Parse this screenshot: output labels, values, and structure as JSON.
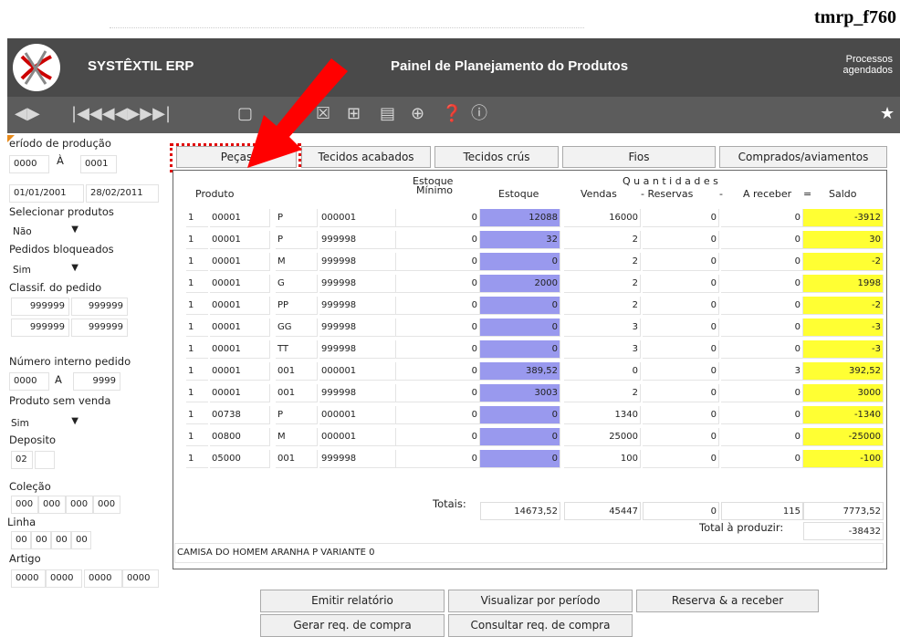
{
  "tag": "tmrp_f760",
  "header": {
    "brand": "SYSTÊXTIL ERP",
    "title": "Painel de Planejamento do Produtos",
    "proc1": "Processos",
    "proc2": "agendados"
  },
  "toolbar": {
    "icons": [
      "nav-first-icon",
      "nav-prev-icon",
      "nav-next-icon",
      "nav-last-icon",
      "new-icon",
      "save-icon",
      "delete-icon",
      "add-icon",
      "print-preview-icon",
      "zoom-icon",
      "help-icon",
      "info-icon",
      "star-icon"
    ]
  },
  "side": {
    "periodo_label": "eríodo de produção",
    "periodo_de": "0000",
    "periodo_a_label": "À",
    "periodo_ate": "0001",
    "data_de": "01/01/2001",
    "data_ate": "28/02/2011",
    "selecionar_label": "Selecionar produtos",
    "selecionar_val": "Não",
    "bloqueados_label": "Pedidos bloqueados",
    "bloqueados_val": "Sim",
    "classif_label": "Classif. do pedido",
    "classif": [
      "999999",
      "999999",
      "999999",
      "999999"
    ],
    "numero_label": "Número interno pedido",
    "numero_de": "0000",
    "numero_a_label": "A",
    "numero_ate": "9999",
    "semvenda_label": "Produto sem venda",
    "semvenda_val": "Sim",
    "deposito_label": "Deposito",
    "deposito_val": "02",
    "deposito_val2": "",
    "colecao_label": "Coleção",
    "colecao": [
      "000",
      "000",
      "000",
      "000"
    ],
    "linha_label": "Linha",
    "linha": [
      "00",
      "00",
      "00",
      "00"
    ],
    "artigo_label": "Artigo",
    "artigo": [
      "0000",
      "0000",
      "0000",
      "0000"
    ]
  },
  "tabs": [
    "Peças",
    "Tecidos acabados",
    "Tecidos crús",
    "Fios",
    "Comprados/aviamentos"
  ],
  "table": {
    "h_produto": "Produto",
    "h_estoque_min_1": "Estoque",
    "h_estoque_min_2": "Mínimo",
    "h_estoque": "Estoque",
    "h_quantidades": "Q u a n t i d a d e s",
    "h_vendas": "Vendas",
    "h_reservas": "- Reservas",
    "h_minus": "-",
    "h_areceber": "A receber",
    "h_eq": "=",
    "h_saldo": "Saldo",
    "rows": [
      [
        "1",
        "00001",
        "P",
        "000001",
        "0",
        "12088",
        "16000",
        "0",
        "0",
        "-3912"
      ],
      [
        "1",
        "00001",
        "P",
        "999998",
        "0",
        "32",
        "2",
        "0",
        "0",
        "30"
      ],
      [
        "1",
        "00001",
        "M",
        "999998",
        "0",
        "0",
        "2",
        "0",
        "0",
        "-2"
      ],
      [
        "1",
        "00001",
        "G",
        "999998",
        "0",
        "2000",
        "2",
        "0",
        "0",
        "1998"
      ],
      [
        "1",
        "00001",
        "PP",
        "999998",
        "0",
        "0",
        "2",
        "0",
        "0",
        "-2"
      ],
      [
        "1",
        "00001",
        "GG",
        "999998",
        "0",
        "0",
        "3",
        "0",
        "0",
        "-3"
      ],
      [
        "1",
        "00001",
        "TT",
        "999998",
        "0",
        "0",
        "3",
        "0",
        "0",
        "-3"
      ],
      [
        "1",
        "00001",
        "001",
        "000001",
        "0",
        "389,52",
        "0",
        "0",
        "3",
        "392,52"
      ],
      [
        "1",
        "00001",
        "001",
        "999998",
        "0",
        "3003",
        "2",
        "0",
        "0",
        "3000"
      ],
      [
        "1",
        "00738",
        "P",
        "000001",
        "0",
        "0",
        "1340",
        "0",
        "0",
        "-1340"
      ],
      [
        "1",
        "00800",
        "M",
        "000001",
        "0",
        "0",
        "25000",
        "0",
        "0",
        "-25000"
      ],
      [
        "1",
        "05000",
        "001",
        "999998",
        "0",
        "0",
        "100",
        "0",
        "0",
        "-100"
      ]
    ],
    "totais_label": "Totais:",
    "tot_estoque": "14673,52",
    "tot_vendas": "45447",
    "tot_reservas": "0",
    "tot_areceber": "115",
    "tot_saldo": "7773,52",
    "total_produzir_label": "Total à produzir:",
    "total_produzir": "-38432",
    "descricao": "CAMISA DO HOMEM ARANHA P VARIANTE 0"
  },
  "buttons": {
    "emitir": "Emitir relatório",
    "visualizar": "Visualizar por período",
    "reserva": "Reserva & a receber",
    "gerar": "Gerar req. de compra",
    "consultar": "Consultar req. de compra"
  },
  "colors": {
    "header": "#4a4a4a",
    "toolbar": "#5c5c5c",
    "estoque": "#9999ee",
    "saldo": "#ffff33",
    "highlight": "#e00000"
  }
}
